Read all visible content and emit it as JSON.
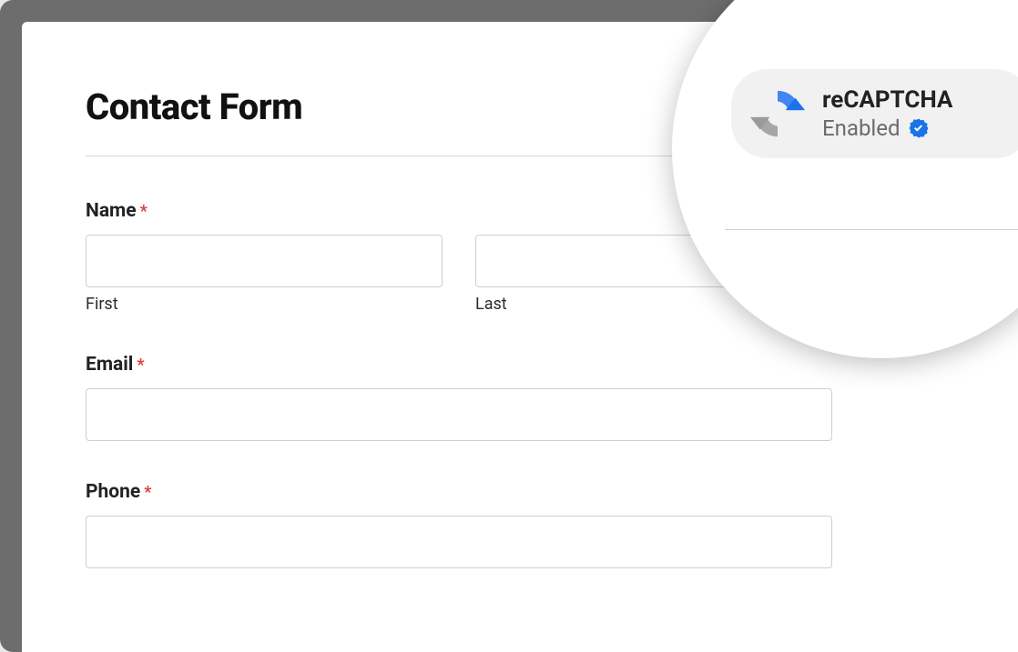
{
  "form": {
    "title": "Contact Form",
    "fields": {
      "name": {
        "label": "Name",
        "required_marker": "*",
        "first_sublabel": "First",
        "last_sublabel": "Last"
      },
      "email": {
        "label": "Email",
        "required_marker": "*"
      },
      "phone": {
        "label": "Phone",
        "required_marker": "*"
      }
    }
  },
  "recaptcha_badge": {
    "title": "reCAPTCHA",
    "status": "Enabled",
    "colors": {
      "blue": "#4285f4",
      "dark_blue": "#1a73e8",
      "gray": "#a6a6a8",
      "verified": "#1a73e8"
    }
  }
}
